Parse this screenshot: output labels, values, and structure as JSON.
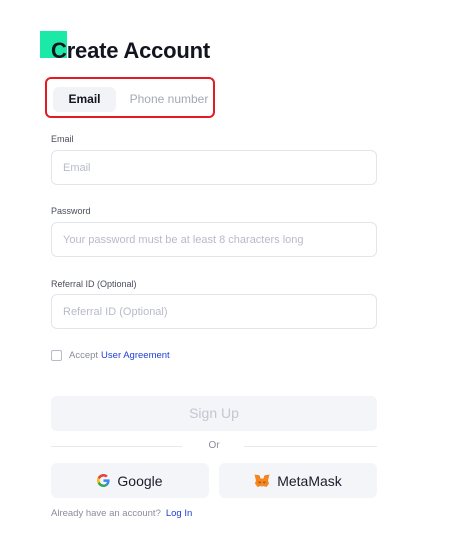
{
  "page": {
    "title": "Create Account"
  },
  "tabs": [
    {
      "label": "Email",
      "active": true
    },
    {
      "label": "Phone number",
      "active": false
    }
  ],
  "form": {
    "email": {
      "label": "Email",
      "placeholder": "Email",
      "value": ""
    },
    "password": {
      "label": "Password",
      "placeholder": "Your password must be at least 8 characters long",
      "value": ""
    },
    "referral": {
      "label": "Referral ID (Optional)",
      "placeholder": "Referral ID (Optional)",
      "value": ""
    },
    "agreement": {
      "prefix": "Accept",
      "link": "User Agreement",
      "checked": false
    },
    "submit_label": "Sign Up"
  },
  "divider_text": "Or",
  "social": {
    "google": {
      "label": "Google",
      "icon": "google-icon"
    },
    "metamask": {
      "label": "MetaMask",
      "icon": "metamask-fox-icon"
    }
  },
  "footer": {
    "prompt": "Already have an account?",
    "link": "Log In"
  },
  "colors": {
    "accent": "#1de9a6",
    "link": "#1e3fd8",
    "highlight_border": "#e31b23"
  }
}
